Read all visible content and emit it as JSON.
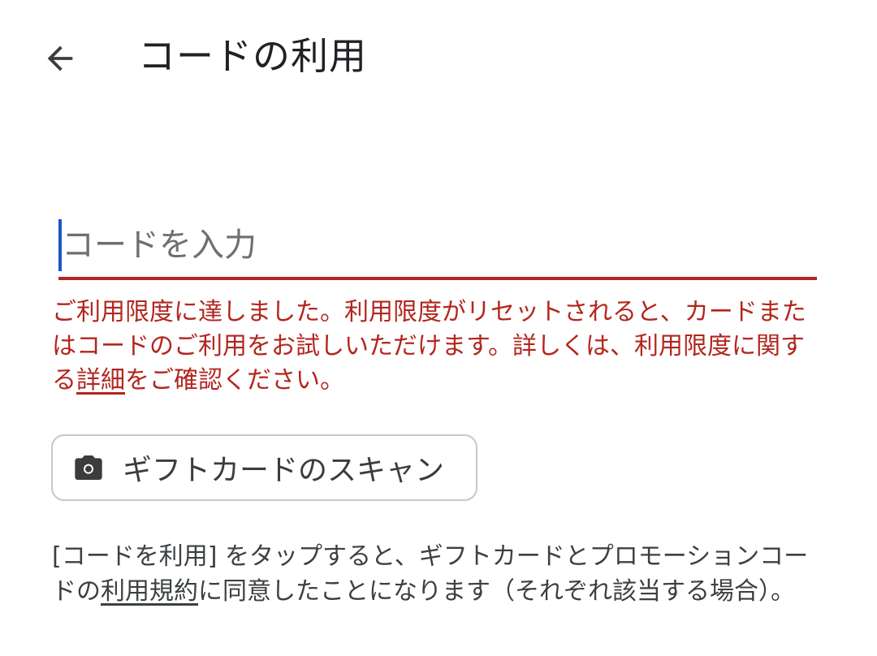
{
  "header": {
    "title": "コードの利用",
    "back_icon": "arrow-left-icon"
  },
  "code_input": {
    "value": "",
    "placeholder": "コードを入力",
    "underline_color": "#b3261e",
    "caret_color": "#1a56c8"
  },
  "error": {
    "text_before": "ご利用限度に達しました。利用限度がリセットされると、カードまたはコードのご利用をお試しいただけます。詳しくは、利用限度に関する",
    "link": "詳細",
    "text_after": "をご確認ください。",
    "color": "#b3261e"
  },
  "scan_button": {
    "label": "ギフトカードのスキャン",
    "icon": "camera-icon"
  },
  "terms": {
    "text_before": "[コードを利用] をタップすると、ギフトカードとプロモーションコードの",
    "link": "利用規約",
    "text_after": "に同意したことになります（それぞれ該当する場合）。"
  }
}
